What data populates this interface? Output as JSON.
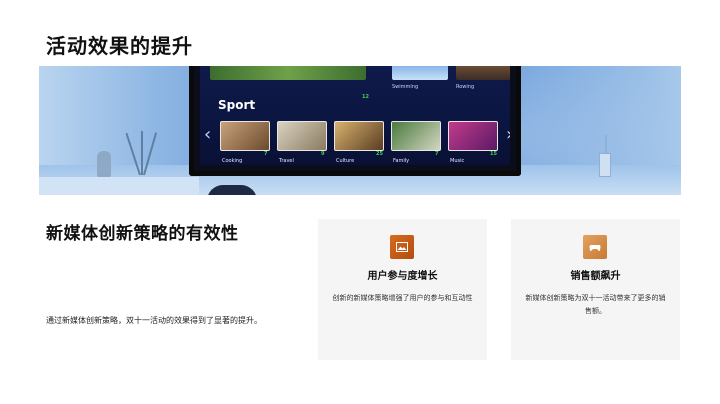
{
  "page": {
    "title": "活动效果的提升",
    "subtitle": "新媒体创新策略的有效性",
    "description": "通过新媒体创新策略，双十一活动的效果得到了显著的提升。"
  },
  "tv_screen": {
    "top_labels": [
      "Swimming",
      "Rowing"
    ],
    "section_title": "Sport",
    "section_badge": "12",
    "categories": [
      {
        "label": "Cooking",
        "badge": "7"
      },
      {
        "label": "Travel",
        "badge": "9"
      },
      {
        "label": "Culture",
        "badge": "25"
      },
      {
        "label": "Family",
        "badge": "7"
      },
      {
        "label": "Music",
        "badge": "15"
      }
    ]
  },
  "cards": [
    {
      "title": "用户参与度增长",
      "text": "创新的新媒体策略增强了用户的参与和互动性",
      "icon": "image-icon",
      "color": "#c85a17"
    },
    {
      "title": "销售额飙升",
      "text": "新媒体创新策略为双十一活动带来了更多的销售额。",
      "icon": "gamepad-icon",
      "color": "#d68a44"
    }
  ]
}
